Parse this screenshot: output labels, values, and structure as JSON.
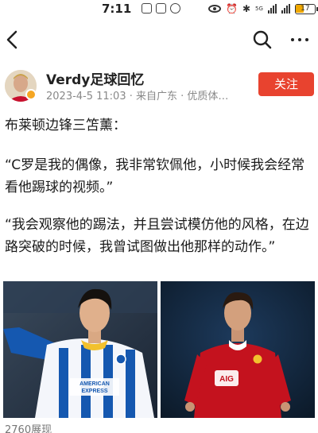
{
  "status_bar": {
    "time": "7:11",
    "network": "5G",
    "battery": "17"
  },
  "author": {
    "name": "Verdy足球回忆",
    "meta": "2023-4-5 11:03 · 来自广东 · 优质体…",
    "follow_label": "关注"
  },
  "post": {
    "paragraphs": [
      "布莱顿边锋三笘薰：",
      "“C罗是我的偶像，我非常钦佩他，小时候我会经常看他踢球的视频。”",
      "“我会观察他的踢法，并且尝试模仿他的风格，在边路突破的时候，我曾试图做出他那样的动作。”"
    ]
  },
  "photos": {
    "left": {
      "sponsor_text": "AMERICAN EXPRESS"
    },
    "right": {
      "sponsor_text": "AIG"
    }
  },
  "footer": {
    "view_count": "2760展现"
  },
  "colors": {
    "accent": "#e8432f",
    "meta_gray": "#888888"
  }
}
